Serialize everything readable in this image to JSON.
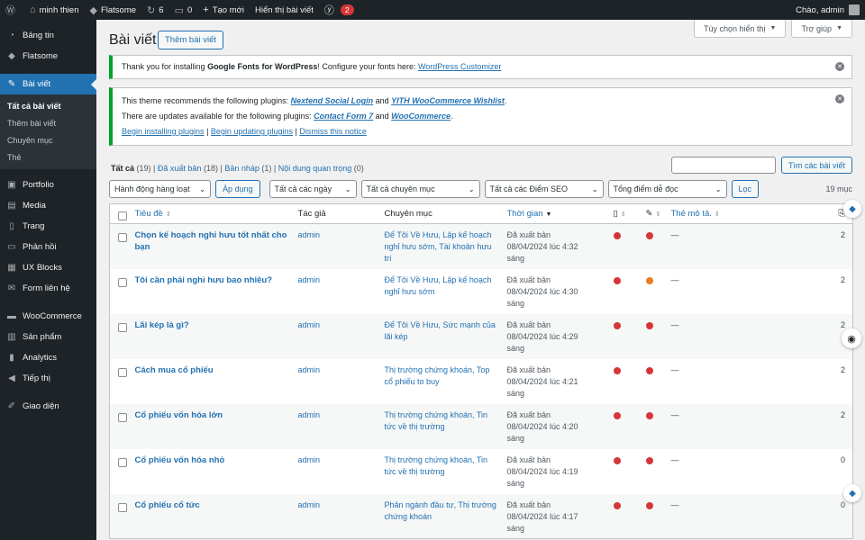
{
  "adminbar": {
    "site_name": "minh thien",
    "theme": "Flatsome",
    "updates": "6",
    "comments": "0",
    "new": "Tạo mới",
    "view_posts": "Hiển thị bài viết",
    "seo_badge": "2",
    "greeting": "Chào, admin"
  },
  "sidebar": {
    "items": [
      {
        "label": "Bảng tin",
        "icon": "dashboard-icon"
      },
      {
        "label": "Flatsome",
        "icon": "flatsome-icon"
      },
      {
        "label": "Bài viết",
        "icon": "pin-icon"
      },
      {
        "label": "Portfolio",
        "icon": "portfolio-icon"
      },
      {
        "label": "Media",
        "icon": "media-icon"
      },
      {
        "label": "Trang",
        "icon": "page-icon"
      },
      {
        "label": "Phản hồi",
        "icon": "comment-icon"
      },
      {
        "label": "UX Blocks",
        "icon": "blocks-icon"
      },
      {
        "label": "Form liên hệ",
        "icon": "mail-icon"
      },
      {
        "label": "WooCommerce",
        "icon": "woo-icon"
      },
      {
        "label": "Sản phẩm",
        "icon": "product-icon"
      },
      {
        "label": "Analytics",
        "icon": "chart-icon"
      },
      {
        "label": "Tiếp thị",
        "icon": "megaphone-icon"
      },
      {
        "label": "Giao diện",
        "icon": "brush-icon"
      }
    ],
    "submenu": [
      "Tất cả bài viết",
      "Thêm bài viết",
      "Chuyên mục",
      "Thẻ"
    ]
  },
  "top": {
    "screen_options": "Tùy chọn hiển thị",
    "help": "Trợ giúp"
  },
  "page": {
    "title": "Bài viết",
    "add_new": "Thêm bài viết"
  },
  "notice1": {
    "pre": "Thank you for installing ",
    "bold": "Google Fonts for WordPress",
    "mid": "! Configure your fonts here: ",
    "link": "WordPress Customizer"
  },
  "notice2": {
    "line1_pre": "This theme recommends the following plugins: ",
    "line1_a": "Nextend Social Login",
    "and1": " and ",
    "line1_b": "YITH WooCommerce Wishlist",
    "dot1": ".",
    "line2_pre": "There are updates available for the following plugins: ",
    "line2_a": "Contact Form 7",
    "and2": " and ",
    "line2_b": "WooCommerce",
    "dot2": ".",
    "act1": "Begin installing plugins",
    "act2": "Begin updating plugins",
    "act3": "Dismiss this notice",
    "pipe": " | "
  },
  "views": [
    {
      "label": "Tất cả",
      "count": "(19)"
    },
    {
      "label": "Đã xuất bản",
      "count": "(18)"
    },
    {
      "label": "Bản nháp",
      "count": "(1)"
    },
    {
      "label": "Nội dung quan trọng",
      "count": "(0)"
    }
  ],
  "search": {
    "button": "Tìm các bài viết"
  },
  "filters": {
    "bulk": "Hành động hàng loạt",
    "apply": "Áp dụng",
    "dates": "Tất cả các ngày",
    "cats": "Tất cả chuyên mục",
    "seo": "Tất cả các Điểm SEO",
    "read": "Tổng điểm dễ đọc",
    "filter": "Lọc",
    "items": "19 mục"
  },
  "columns": {
    "title": "Tiêu đề",
    "author": "Tác giả",
    "category": "Chuyên mục",
    "date": "Thời gian",
    "tags": "Thẻ mô tả."
  },
  "colors": {
    "red": "#d63638",
    "orange": "#e67e22"
  },
  "rows": [
    {
      "title": "Chọn kế hoạch nghỉ hưu tốt nhất cho bạn",
      "author": "admin",
      "cats": "Để Tôi Về Hưu, Lập kế hoạch nghỉ hưu sớm, Tài khoản hưu trí",
      "status": "Đã xuất bản",
      "date": "08/04/2024 lúc 4:32",
      "ampm": "sáng",
      "seo": "red",
      "read": "red",
      "tags": "—",
      "links": "2"
    },
    {
      "title": "Tôi cần phải nghỉ hưu bao nhiêu?",
      "author": "admin",
      "cats": "Để Tôi Về Hưu, Lập kế hoạch nghỉ hưu sớm",
      "status": "Đã xuất bản",
      "date": "08/04/2024 lúc 4:30",
      "ampm": "sáng",
      "seo": "red",
      "read": "orange",
      "tags": "—",
      "links": "2"
    },
    {
      "title": "Lãi kép là gì?",
      "author": "admin",
      "cats": "Để Tôi Về Hưu, Sức mạnh của lãi kép",
      "status": "Đã xuất bản",
      "date": "08/04/2024 lúc 4:29",
      "ampm": "sáng",
      "seo": "red",
      "read": "red",
      "tags": "—",
      "links": "2"
    },
    {
      "title": "Cách mua cổ phiếu",
      "author": "admin",
      "cats": "Thị trường chứng khoán, Top cổ phiếu to buy",
      "status": "Đã xuất bản",
      "date": "08/04/2024 lúc 4:21",
      "ampm": "sáng",
      "seo": "red",
      "read": "red",
      "tags": "—",
      "links": "2"
    },
    {
      "title": "Cổ phiếu vốn hóa lớn",
      "author": "admin",
      "cats": "Thị trường chứng khoán, Tin tức về thị trường",
      "status": "Đã xuất bản",
      "date": "08/04/2024 lúc 4:20",
      "ampm": "sáng",
      "seo": "red",
      "read": "red",
      "tags": "—",
      "links": "2"
    },
    {
      "title": "Cổ phiếu vốn hóa nhỏ",
      "author": "admin",
      "cats": "Thị trường chứng khoán, Tin tức về thị trường",
      "status": "Đã xuất bản",
      "date": "08/04/2024 lúc 4:19",
      "ampm": "sáng",
      "seo": "red",
      "read": "red",
      "tags": "—",
      "links": "0"
    },
    {
      "title": "Cổ phiếu cổ tức",
      "author": "admin",
      "cats": "Phân ngành đầu tư, Thị trường chứng khoán",
      "status": "Đã xuất bản",
      "date": "08/04/2024 lúc 4:17",
      "ampm": "sáng",
      "seo": "red",
      "read": "red",
      "tags": "—",
      "links": "0"
    }
  ]
}
